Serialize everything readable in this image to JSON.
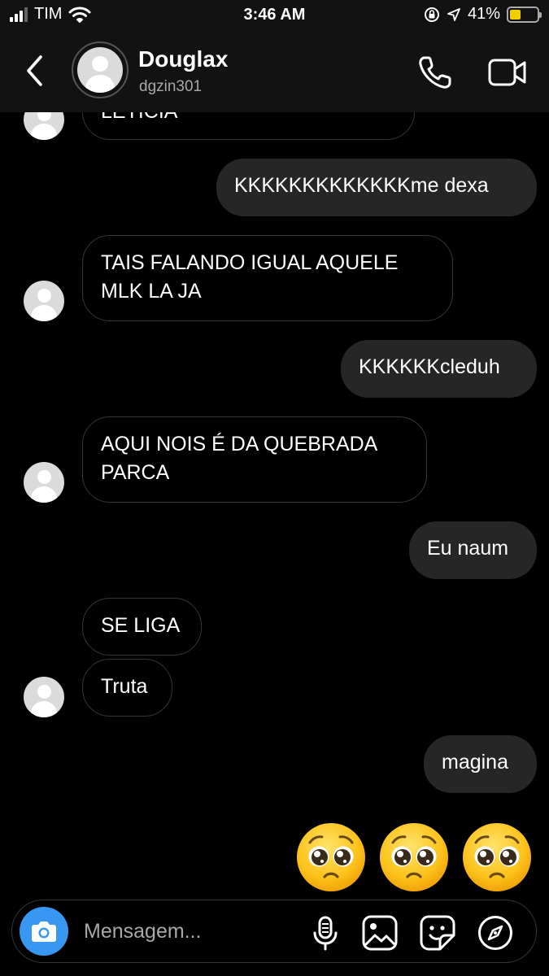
{
  "status_bar": {
    "carrier": "TIM",
    "time": "3:46 AM",
    "battery_percent": "41%",
    "battery_level": 0.41,
    "icons": [
      "signal-icon",
      "wifi-icon",
      "orientation-lock-icon",
      "location-icon",
      "battery-icon"
    ]
  },
  "header": {
    "name": "Douglax",
    "username": "dgzin301",
    "icons": [
      "back-chevron-icon",
      "phone-icon",
      "video-camera-icon"
    ]
  },
  "messages": [
    {
      "from": "them",
      "text": "LETICIA",
      "show_avatar": true
    },
    {
      "from": "me",
      "text": "KKKKKKKKKKKKKme dexa"
    },
    {
      "from": "them",
      "text": "TAIS FALANDO IGUAL AQUELE\nMLK LA JA",
      "show_avatar": true
    },
    {
      "from": "me",
      "text": "KKKKKKcleduh"
    },
    {
      "from": "them",
      "text": "AQUI NOIS É DA QUEBRADA\nPARCA",
      "show_avatar": true
    },
    {
      "from": "me",
      "text": "Eu naum"
    },
    {
      "from": "them",
      "text": "SE LIGA",
      "show_avatar": false
    },
    {
      "from": "them",
      "text": "Truta",
      "show_avatar": true
    },
    {
      "from": "me",
      "text": "magina"
    },
    {
      "from": "me",
      "type": "emoji",
      "emoji": "pleading-face",
      "count": 3
    }
  ],
  "composer": {
    "placeholder": "Mensagem...",
    "icons": [
      "camera-icon",
      "microphone-icon",
      "gallery-icon",
      "sticker-icon",
      "compass-icon"
    ]
  },
  "colors": {
    "background": "#000000",
    "bars": "#121212",
    "outgoing_bubble": "#262626",
    "incoming_border": "#363636",
    "camera_button": "#3897f0",
    "battery_fill": "#f2cd00"
  }
}
